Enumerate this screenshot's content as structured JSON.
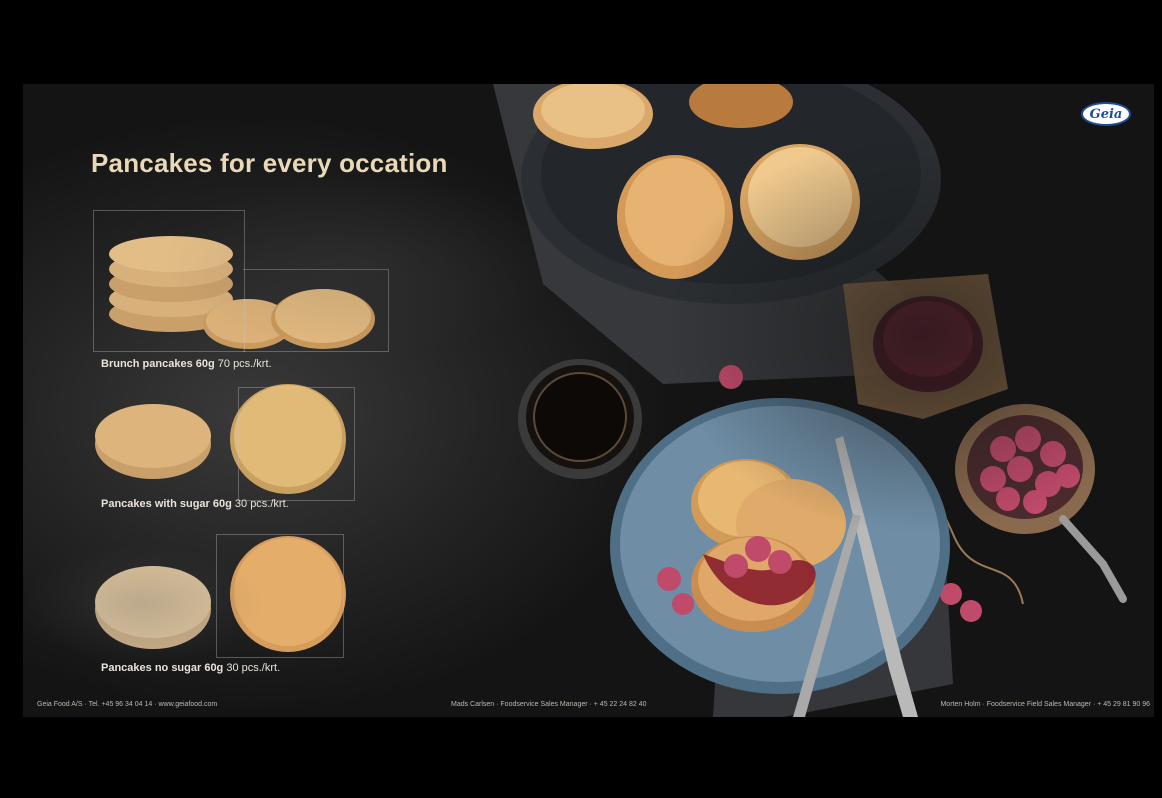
{
  "slide": {
    "title": "Pancakes for every occation",
    "logo_text": "Geia",
    "products": [
      {
        "name": "Brunch pancakes 60g",
        "detail": " 70 pcs./krt."
      },
      {
        "name": "Pancakes with sugar 60g",
        "detail": " 30 pcs./krt."
      },
      {
        "name": "Pancakes no sugar 60g",
        "detail": " 30 pcs./krt."
      }
    ],
    "footer": {
      "left": "Geia Food A/S  ·  Tel. +45 96 34 04 14  ·  www.geiafood.com",
      "center": "Mads Carlsen  ·  Foodservice Sales Manager  ·  + 45 22 24 82 40",
      "right": "Morten Holm  ·  Foodservice Field Sales Manager  ·  + 45 29 81 90 96"
    }
  },
  "colors": {
    "title": "#e9d9b8",
    "background": "#000000",
    "pancake": "#e2b877",
    "plate_dark": "#2b2f33",
    "plate_blue": "#6f8ea6",
    "raspberry": "#c04a6a"
  }
}
